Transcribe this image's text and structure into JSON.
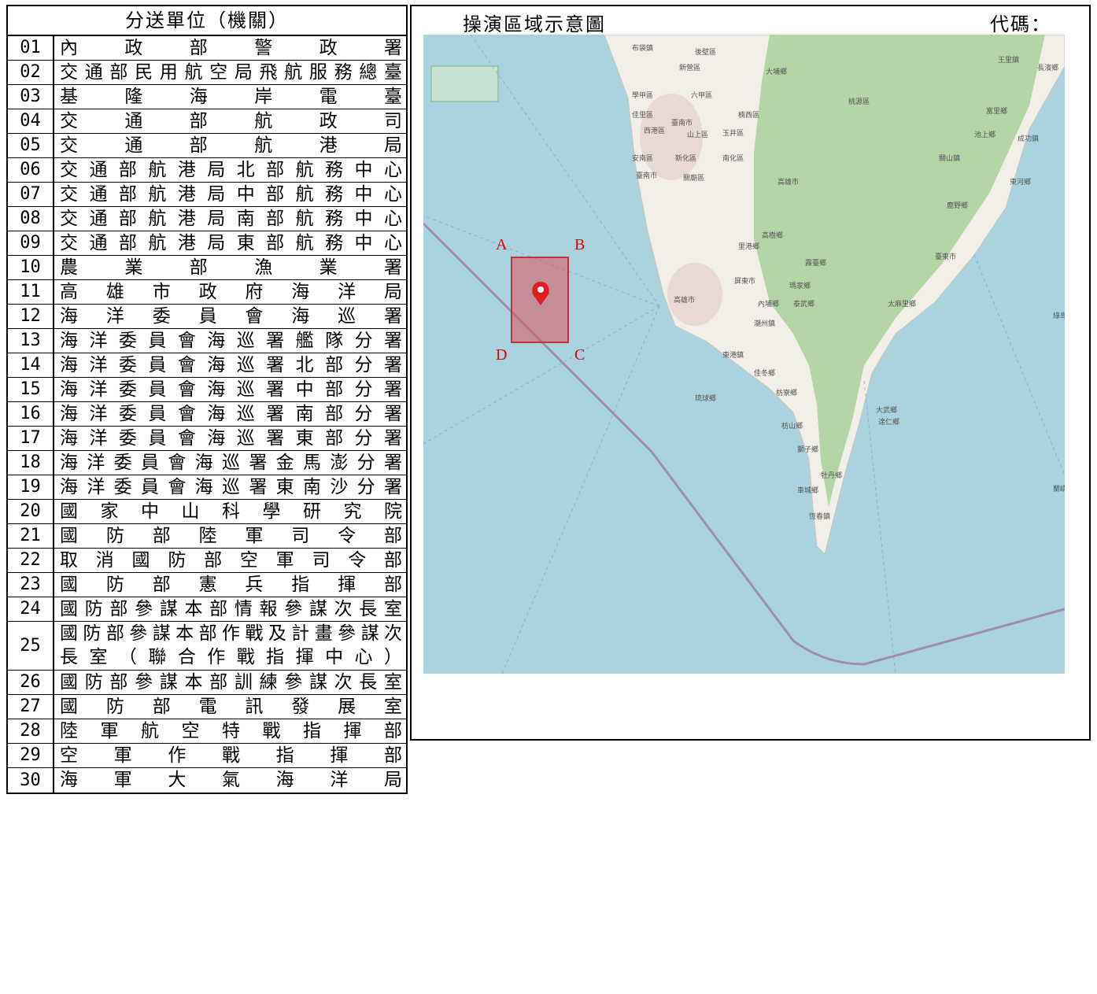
{
  "units_table": {
    "header": "分送單位（機關）",
    "rows": [
      {
        "num": "01",
        "name": "內政部警政署"
      },
      {
        "num": "02",
        "name": "交通部民用航空局飛航服務總臺"
      },
      {
        "num": "03",
        "name": "基隆海岸電臺"
      },
      {
        "num": "04",
        "name": "交通部航政司"
      },
      {
        "num": "05",
        "name": "交通部航港局"
      },
      {
        "num": "06",
        "name": "交通部航港局北部航務中心"
      },
      {
        "num": "07",
        "name": "交通部航港局中部航務中心"
      },
      {
        "num": "08",
        "name": "交通部航港局南部航務中心"
      },
      {
        "num": "09",
        "name": "交通部航港局東部航務中心"
      },
      {
        "num": "10",
        "name": "農業部漁業署"
      },
      {
        "num": "11",
        "name": "高雄市政府海洋局"
      },
      {
        "num": "12",
        "name": "海洋委員會海巡署"
      },
      {
        "num": "13",
        "name": "海洋委員會海巡署艦隊分署"
      },
      {
        "num": "14",
        "name": "海洋委員會海巡署北部分署"
      },
      {
        "num": "15",
        "name": "海洋委員會海巡署中部分署"
      },
      {
        "num": "16",
        "name": "海洋委員會海巡署南部分署"
      },
      {
        "num": "17",
        "name": "海洋委員會海巡署東部分署"
      },
      {
        "num": "18",
        "name": "海洋委員會海巡署金馬澎分署"
      },
      {
        "num": "19",
        "name": "海洋委員會海巡署東南沙分署"
      },
      {
        "num": "20",
        "name": "國家中山科學研究院"
      },
      {
        "num": "21",
        "name": "國防部陸軍司令部"
      },
      {
        "num": "22",
        "name": "取消國防部空軍司令部"
      },
      {
        "num": "23",
        "name": "國防部憲兵指揮部"
      },
      {
        "num": "24",
        "name": "國防部參謀本部情報參謀次長室"
      },
      {
        "num": "25",
        "name_line1": "國防部參謀本部作戰及計畫參謀次",
        "name_line2": "長室（聯合作戰指揮中心）"
      },
      {
        "num": "26",
        "name": "國防部參謀本部訓練參謀次長室"
      },
      {
        "num": "27",
        "name": "國防部電訊發展室"
      },
      {
        "num": "28",
        "name": "陸軍航空特戰指揮部"
      },
      {
        "num": "29",
        "name": "空軍作戰指揮部"
      },
      {
        "num": "30",
        "name": "海軍大氣海洋局"
      }
    ]
  },
  "map_panel": {
    "title": "操演區域示意圖",
    "code_label": "代碼：",
    "corners": {
      "a": "A",
      "b": "B",
      "c": "C",
      "d": "D"
    },
    "place_labels": [
      "布袋鎮",
      "後壁區",
      "大埔鄉",
      "新營區",
      "學甲區",
      "六甲區",
      "桃源區",
      "佳里區",
      "臺南市",
      "楠西區",
      "西港區",
      "山上區",
      "玉井區",
      "安南區",
      "新化區",
      "南化區",
      "臺南市",
      "關廟區",
      "高雄市",
      "高樹鄉",
      "里港鄉",
      "霧臺鄉",
      "屏東市",
      "瑪家鄉",
      "高雄市",
      "內埔鄉",
      "泰武鄉",
      "潮州鎮",
      "東港鎮",
      "佳冬鄉",
      "枋寮鄉",
      "琉球鄉",
      "枋山鄉",
      "大武鄉",
      "達仁鄉",
      "獅子鄉",
      "牡丹鄉",
      "車城鄉",
      "恆春鎮",
      "臺東市",
      "鹿野鄉",
      "東河鄉",
      "關山鎮",
      "池上鄉",
      "富里鄉",
      "成功鎮",
      "太麻里鄉",
      "王里鎮",
      "長濱鄉",
      "綠島",
      "蘭嶼"
    ],
    "colors": {
      "sea": "#aad3df",
      "land": "#f2efe9",
      "forest": "#add19e",
      "exercise_area": "#d9545c",
      "marker": "#e31b23"
    }
  }
}
